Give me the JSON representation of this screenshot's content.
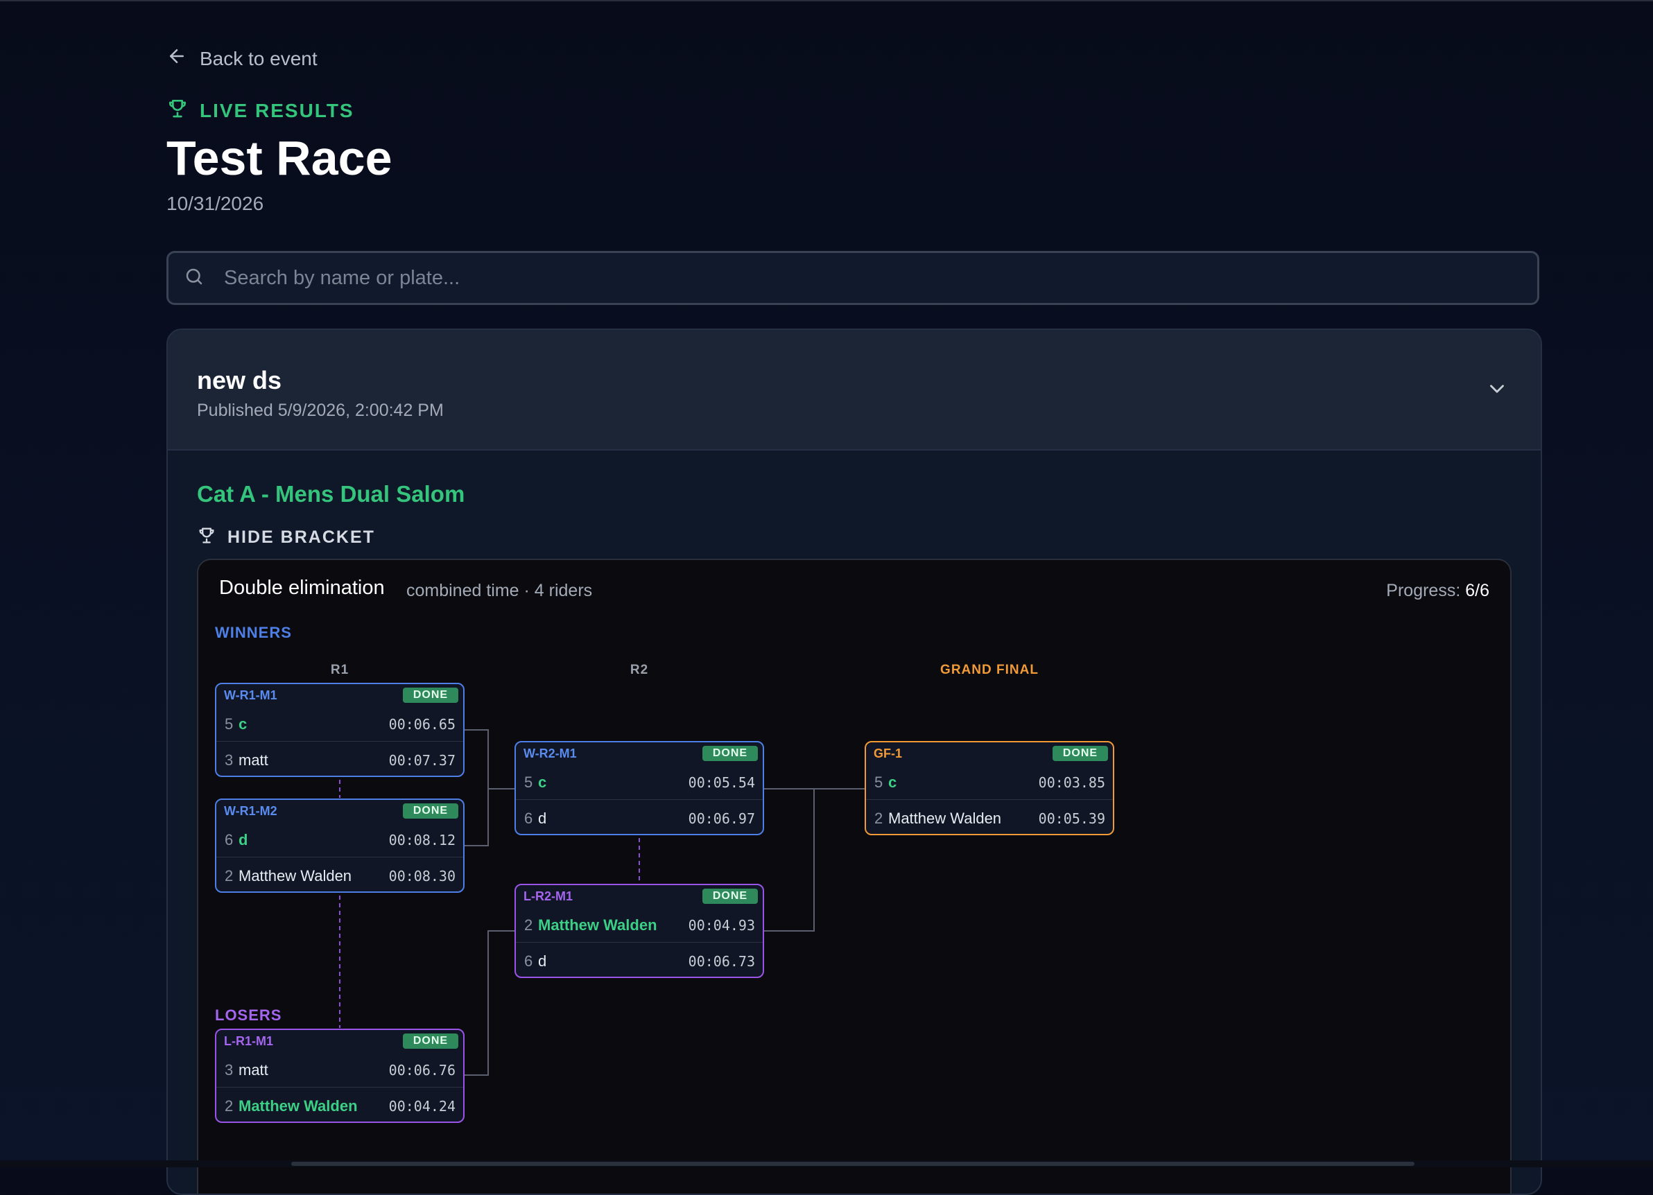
{
  "nav": {
    "back_label": "Back to event"
  },
  "header": {
    "kicker": "LIVE RESULTS",
    "title": "Test Race",
    "date": "10/31/2026"
  },
  "search": {
    "placeholder": "Search by name or plate...",
    "value": ""
  },
  "results": {
    "name": "new ds",
    "published": "Published 5/9/2026, 2:00:42 PM",
    "category": "Cat A - Mens Dual Salom",
    "toggle_label": "HIDE BRACKET"
  },
  "bracket": {
    "format": "Double elimination",
    "meta": "combined time · 4 riders",
    "progress_label": "Progress:",
    "progress_value": "6/6",
    "winners_label": "WINNERS",
    "losers_label": "LOSERS",
    "columns": {
      "r1": "R1",
      "r2": "R2",
      "gf": "GRAND FINAL"
    },
    "matches": [
      {
        "id": "W-R1-M1",
        "status": "DONE",
        "rows": [
          {
            "plate": "5",
            "name": "c",
            "time": "00:06.65",
            "winner": true
          },
          {
            "plate": "3",
            "name": "matt",
            "time": "00:07.37",
            "winner": false
          }
        ]
      },
      {
        "id": "W-R1-M2",
        "status": "DONE",
        "rows": [
          {
            "plate": "6",
            "name": "d",
            "time": "00:08.12",
            "winner": true
          },
          {
            "plate": "2",
            "name": "Matthew Walden",
            "time": "00:08.30",
            "winner": false
          }
        ]
      },
      {
        "id": "W-R2-M1",
        "status": "DONE",
        "rows": [
          {
            "plate": "5",
            "name": "c",
            "time": "00:05.54",
            "winner": true
          },
          {
            "plate": "6",
            "name": "d",
            "time": "00:06.97",
            "winner": false
          }
        ]
      },
      {
        "id": "L-R2-M1",
        "status": "DONE",
        "rows": [
          {
            "plate": "2",
            "name": "Matthew Walden",
            "time": "00:04.93",
            "winner": true
          },
          {
            "plate": "6",
            "name": "d",
            "time": "00:06.73",
            "winner": false
          }
        ]
      },
      {
        "id": "GF-1",
        "status": "DONE",
        "rows": [
          {
            "plate": "5",
            "name": "c",
            "time": "00:03.85",
            "winner": true
          },
          {
            "plate": "2",
            "name": "Matthew Walden",
            "time": "00:05.39",
            "winner": false
          }
        ]
      },
      {
        "id": "L-R1-M1",
        "status": "DONE",
        "rows": [
          {
            "plate": "3",
            "name": "matt",
            "time": "00:06.76",
            "winner": false
          },
          {
            "plate": "2",
            "name": "Matthew Walden",
            "time": "00:04.24",
            "winner": true
          }
        ]
      }
    ]
  },
  "colors": {
    "accent_green": "#34c47c",
    "winners_blue": "#4e7fe6",
    "losers_purple": "#9a55e8",
    "final_orange": "#f29a38",
    "done_badge": "#2e8a5a"
  }
}
